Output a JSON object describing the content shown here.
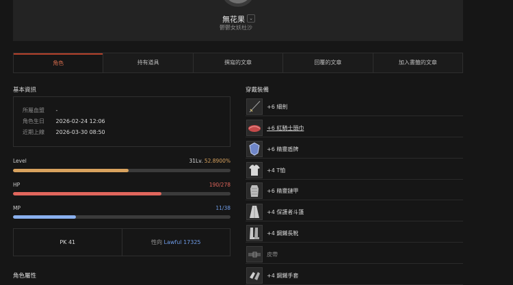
{
  "profile": {
    "name": "無花果",
    "dropdown_icon": "chevron-down-icon",
    "class_line": "鬱鬱女妖杜沙"
  },
  "tabs": [
    {
      "label": "角色",
      "active": true
    },
    {
      "label": "持有道具",
      "active": false
    },
    {
      "label": "撰寫的文章",
      "active": false
    },
    {
      "label": "回覆的文章",
      "active": false
    },
    {
      "label": "加入書籤的文章",
      "active": false
    }
  ],
  "basic_info": {
    "title": "基本資訊",
    "rows": [
      {
        "key": "所屬血盟",
        "value": "-"
      },
      {
        "key": "角色生日",
        "value": "2026-02-24 12:06"
      },
      {
        "key": "近期上線",
        "value": "2026-03-30 08:50"
      }
    ]
  },
  "stats": {
    "level": {
      "label": "Level",
      "value_main": "31Lv.",
      "value_pct": "52.8900%",
      "fill_fraction": 0.53,
      "color": "#d8a25e",
      "value_color": "#d8a25e"
    },
    "hp": {
      "label": "HP",
      "value": "190/278",
      "fill_fraction": 0.683,
      "color": "#e1665c",
      "value_color": "#e1665c"
    },
    "mp": {
      "label": "MP",
      "value": "11/38",
      "fill_fraction": 0.29,
      "color": "#8ab0ee",
      "value_color": "#6f9ce8"
    }
  },
  "pk": {
    "pk_label": "PK",
    "pk_value": "41",
    "align_label": "性向",
    "align_value": "Lawful 17325",
    "align_color": "#6f9ce8"
  },
  "attributes_title": "角色屬性",
  "equipment": {
    "title": "穿戴裝備",
    "items": [
      {
        "name": "+6 細劍",
        "icon": "rapier-icon",
        "style": ""
      },
      {
        "name": "+6 紅騎士頭巾",
        "icon": "red-bandana-icon",
        "style": "link"
      },
      {
        "name": "+6 精靈盾牌",
        "icon": "elven-shield-icon",
        "style": ""
      },
      {
        "name": "+4 T恤",
        "icon": "tshirt-icon",
        "style": ""
      },
      {
        "name": "+6 精靈鏈甲",
        "icon": "chainmail-icon",
        "style": ""
      },
      {
        "name": "+4 保護者斗篷",
        "icon": "cloak-icon",
        "style": ""
      },
      {
        "name": "+4 鋼鐵長靴",
        "icon": "boots-icon",
        "style": ""
      },
      {
        "name": "皮帶",
        "icon": "belt-icon",
        "style": "dim"
      },
      {
        "name": "+4 鋼鐵手套",
        "icon": "gloves-icon",
        "style": ""
      }
    ]
  }
}
